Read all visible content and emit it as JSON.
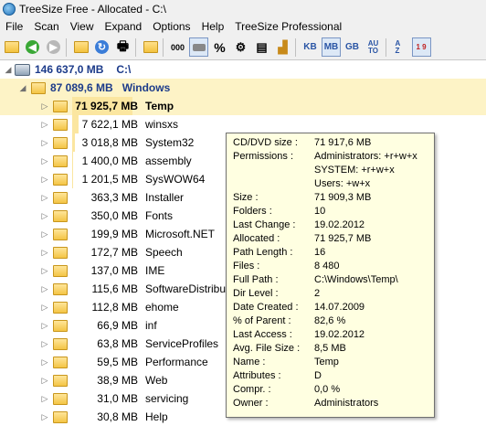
{
  "window": {
    "title": "TreeSize Free - Allocated - C:\\"
  },
  "menu": [
    "File",
    "Scan",
    "View",
    "Expand",
    "Options",
    "Help",
    "TreeSize Professional"
  ],
  "toolbar": {
    "digits_label": "000",
    "percent_label": "%",
    "units": [
      "KB",
      "MB",
      "GB"
    ],
    "auto_label": "AU TO",
    "sort_az_label": "A Z",
    "sort_19_label": "1 9"
  },
  "tree": {
    "drive": {
      "size": "146 637,0 MB",
      "name": "C:\\"
    },
    "windows": {
      "size": "87 089,6 MB",
      "name": "Windows"
    },
    "items": [
      {
        "size": "71 925,7 MB",
        "name": "Temp",
        "fraction": 0.826
      },
      {
        "size": "7 622,1 MB",
        "name": "winsxs",
        "fraction": 0.088
      },
      {
        "size": "3 018,8 MB",
        "name": "System32",
        "fraction": 0.035
      },
      {
        "size": "1 400,0 MB",
        "name": "assembly",
        "fraction": 0.016
      },
      {
        "size": "1 201,5 MB",
        "name": "SysWOW64",
        "fraction": 0.014
      },
      {
        "size": "363,3 MB",
        "name": "Installer",
        "fraction": 0.004
      },
      {
        "size": "350,0 MB",
        "name": "Fonts",
        "fraction": 0.004
      },
      {
        "size": "199,9 MB",
        "name": "Microsoft.NET",
        "fraction": 0.002
      },
      {
        "size": "172,7 MB",
        "name": "Speech",
        "fraction": 0.002
      },
      {
        "size": "137,0 MB",
        "name": "IME",
        "fraction": 0.002
      },
      {
        "size": "115,6 MB",
        "name": "SoftwareDistribu",
        "fraction": 0.001
      },
      {
        "size": "112,8 MB",
        "name": "ehome",
        "fraction": 0.001
      },
      {
        "size": "66,9 MB",
        "name": "inf",
        "fraction": 0.001
      },
      {
        "size": "63,8 MB",
        "name": "ServiceProfiles",
        "fraction": 0.001
      },
      {
        "size": "59,5 MB",
        "name": "Performance",
        "fraction": 0.001
      },
      {
        "size": "38,9 MB",
        "name": "Web",
        "fraction": 0.0
      },
      {
        "size": "31,0 MB",
        "name": "servicing",
        "fraction": 0.0
      },
      {
        "size": "30,8 MB",
        "name": "Help",
        "fraction": 0.0
      }
    ]
  },
  "tooltip": {
    "rows": [
      {
        "label": "CD/DVD size :",
        "value": "71 917,6 MB"
      },
      {
        "label": "Permissions :",
        "value": "Administrators: +r+w+x"
      },
      {
        "label": "",
        "value": "SYSTEM: +r+w+x"
      },
      {
        "label": "",
        "value": "Users: +w+x"
      },
      {
        "label": "Size :",
        "value": "71 909,3 MB"
      },
      {
        "label": "Folders :",
        "value": "10"
      },
      {
        "label": "Last Change :",
        "value": "19.02.2012"
      },
      {
        "label": "Allocated :",
        "value": "71 925,7 MB"
      },
      {
        "label": "Path Length :",
        "value": "16"
      },
      {
        "label": "Files :",
        "value": "8 480"
      },
      {
        "label": "Full Path :",
        "value": "C:\\Windows\\Temp\\"
      },
      {
        "label": "Dir Level :",
        "value": "2"
      },
      {
        "label": "Date Created :",
        "value": "14.07.2009"
      },
      {
        "label": "% of Parent :",
        "value": "82,6 %"
      },
      {
        "label": "Last Access :",
        "value": "19.02.2012"
      },
      {
        "label": "Avg. File Size :",
        "value": "8,5 MB"
      },
      {
        "label": "Name :",
        "value": "Temp"
      },
      {
        "label": "Attributes :",
        "value": "D"
      },
      {
        "label": "Compr. :",
        "value": "0,0 %"
      },
      {
        "label": "Owner :",
        "value": "Administrators"
      }
    ]
  }
}
